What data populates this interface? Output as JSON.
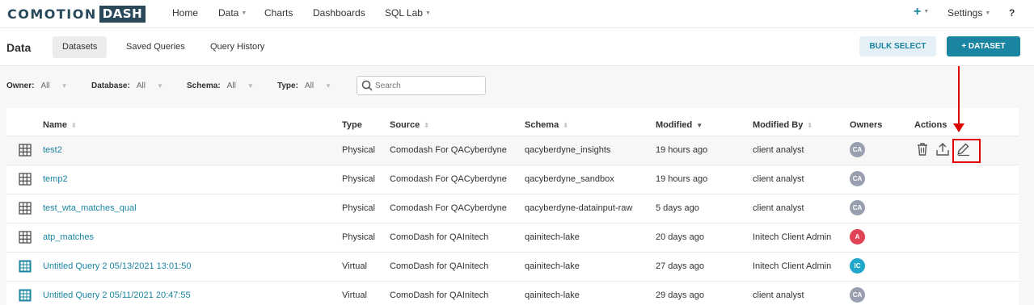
{
  "nav": {
    "logo_part1": "COMOTION",
    "logo_part2": "DASH",
    "items": [
      {
        "label": "Home"
      },
      {
        "label": "Data"
      },
      {
        "label": "Charts"
      },
      {
        "label": "Dashboards"
      },
      {
        "label": "SQL Lab"
      }
    ],
    "plus": "+",
    "settings": "Settings",
    "help": "?"
  },
  "header": {
    "title": "Data",
    "tabs": [
      {
        "label": "Datasets",
        "active": true
      },
      {
        "label": "Saved Queries"
      },
      {
        "label": "Query History"
      }
    ],
    "bulk_select": "BULK SELECT",
    "add_dataset": "+ DATASET"
  },
  "filters": [
    {
      "label": "Owner:",
      "value": "All"
    },
    {
      "label": "Database:",
      "value": "All"
    },
    {
      "label": "Schema:",
      "value": "All"
    },
    {
      "label": "Type:",
      "value": "All"
    }
  ],
  "search": {
    "placeholder": "Search"
  },
  "table": {
    "columns": [
      "Name",
      "Type",
      "Source",
      "Schema",
      "Modified",
      "Modified By",
      "Owners",
      "Actions"
    ],
    "rows": [
      {
        "icon": "table-icon",
        "name": "test2",
        "type": "Physical",
        "source": "Comodash For QACyberdyne",
        "schema": "qacyberdyne_insights",
        "modified": "19 hours ago",
        "modified_by": "client analyst",
        "owner": "CA",
        "owner_color": "#9a9fb0"
      },
      {
        "icon": "table-icon",
        "name": "temp2",
        "type": "Physical",
        "source": "Comodash For QACyberdyne",
        "schema": "qacyberdyne_sandbox",
        "modified": "19 hours ago",
        "modified_by": "client analyst",
        "owner": "CA",
        "owner_color": "#9a9fb0"
      },
      {
        "icon": "table-icon",
        "name": "test_wta_matches_qual",
        "type": "Physical",
        "source": "Comodash For QACyberdyne",
        "schema": "qacyberdyne-datainput-raw",
        "modified": "5 days ago",
        "modified_by": "client analyst",
        "owner": "CA",
        "owner_color": "#9a9fb0"
      },
      {
        "icon": "table-icon",
        "name": "atp_matches",
        "type": "Physical",
        "source": "ComoDash for QAInitech",
        "schema": "qainitech-lake",
        "modified": "20 days ago",
        "modified_by": "Initech Client Admin",
        "owner": "A",
        "owner_color": "#e04355"
      },
      {
        "icon": "virtual-table-icon",
        "name": "Untitled Query 2 05/13/2021 13:01:50",
        "type": "Virtual",
        "source": "ComoDash for QAInitech",
        "schema": "qainitech-lake",
        "modified": "27 days ago",
        "modified_by": "Initech Client Admin",
        "owner": "IC",
        "owner_color": "#20a7c9"
      },
      {
        "icon": "virtual-table-icon",
        "name": "Untitled Query 2 05/11/2021 20:47:55",
        "type": "Virtual",
        "source": "ComoDash for QAInitech",
        "schema": "qainitech-lake",
        "modified": "29 days ago",
        "modified_by": "client analyst",
        "owner": "CA",
        "owner_color": "#9a9fb0"
      }
    ]
  },
  "colors": {
    "accent": "#1a85a0",
    "annotation": "#e30000"
  }
}
